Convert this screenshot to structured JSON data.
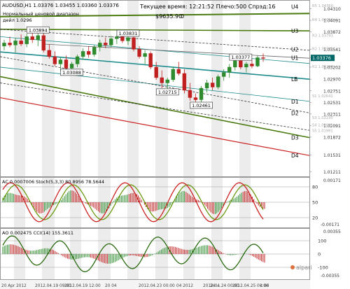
{
  "header": {
    "symbol_line": "AUDUSD,H1  1.03376 1.03455 1.03360 1.03376",
    "info_lines": [
      "Нормальный ценовой диапазон",
      "дейл 1.0296"
    ],
    "time_label": "Текущее время: 12:21:52 Плечо:500 Спрэд:16",
    "balance": "$9635.90",
    "zero": "0"
  },
  "colors": {
    "up_candle": "#2e8b2e",
    "down_candle": "#c02020",
    "u_lines": "#4a7a10",
    "l_lines": "#1e8c8c",
    "d4_line": "#cc2222",
    "stoch_main": "#cc2222",
    "stoch_signal": "#6a9a10",
    "cci_line": "#2a6a10",
    "stripe": "#ececec",
    "price_box": "#006666"
  },
  "channel_labels": [
    {
      "text": "U4",
      "price": 1.0435
    },
    {
      "text": "U3",
      "price": 1.0389
    },
    {
      "text": "U2",
      "price": 1.0354
    },
    {
      "text": "U1",
      "price": 1.03376
    },
    {
      "text": "LB",
      "price": 1.0297
    },
    {
      "text": "D1",
      "price": 1.0255
    },
    {
      "text": "D2",
      "price": 1.0233
    },
    {
      "text": "D3",
      "price": 1.0186
    },
    {
      "text": "D4",
      "price": 1.0152
    }
  ],
  "price_axis": {
    "ticks": [
      "1.04310",
      "1.04091",
      "1.03872",
      "1.03541",
      "1.03376",
      "1.03202",
      "1.02970",
      "1.02751",
      "1.02531",
      "1.02311",
      "1.02091",
      "1.01872",
      "1.01531",
      "1.01211"
    ],
    "current_price": "1.03376",
    "level_tags": [
      {
        "text": "R5 1.04360",
        "price": 1.0436
      },
      {
        "text": "R4 1.04091",
        "price": 1.0409
      },
      {
        "text": "R3 1.03791",
        "price": 1.0379
      },
      {
        "text": "R2 1.03541",
        "price": 1.0354
      },
      {
        "text": "R1 1.03202",
        "price": 1.032
      },
      {
        "text": "S1 1.02641",
        "price": 1.0264
      },
      {
        "text": "S3 1.02230",
        "price": 1.0223
      },
      {
        "text": "S4 1.02091",
        "price": 1.0209
      },
      {
        "text": "S5 1.01981",
        "price": 1.0198
      }
    ]
  },
  "price_annotations": [
    {
      "text": "1.03894",
      "price": 1.03894,
      "bar": 6
    },
    {
      "text": "1.03088",
      "price": 1.03088,
      "bar": 12
    },
    {
      "text": "1.03831",
      "price": 1.03831,
      "bar": 22
    },
    {
      "text": "1.02715",
      "price": 1.02715,
      "bar": 29
    },
    {
      "text": "1.03377",
      "price": 1.03377,
      "bar": 42
    },
    {
      "text": "1.02461",
      "price": 1.02461,
      "bar": 35
    }
  ],
  "indicator1": {
    "label": "AC 0.0007006  Stoch(5,3,3) 80.8956 78.5644",
    "levels": [
      "80",
      "50",
      "20"
    ],
    "ticks": [
      "0.00171",
      "-0.00171"
    ]
  },
  "indicator2": {
    "label": "AO 0.002475  CCI(14) 155.3611",
    "levels": [
      "100",
      "0",
      "-100"
    ],
    "ticks": [
      "0.00355",
      "-0.00355"
    ],
    "watermark": "alpari"
  },
  "time_axis": [
    "20 Apr 2012",
    "2012.04.19 09:00",
    "2012.04.19 12:00",
    "20 04",
    "2012.04.23 00:00",
    "04 2012",
    "2012.04.24 00:00",
    "24 ...",
    "2012.04.25 00:00",
    "c 04"
  ],
  "chart_data": {
    "type": "candlestick",
    "symbol": "AUDUSD",
    "timeframe": "H1",
    "ohlc": [
      [
        1.036,
        1.0372,
        1.0352,
        1.0366
      ],
      [
        1.0366,
        1.0378,
        1.0358,
        1.0362
      ],
      [
        1.0362,
        1.0375,
        1.0348,
        1.037
      ],
      [
        1.037,
        1.0382,
        1.036,
        1.0364
      ],
      [
        1.0364,
        1.0384,
        1.0358,
        1.0378
      ],
      [
        1.0378,
        1.0389,
        1.0366,
        1.0372
      ],
      [
        1.0372,
        1.0386,
        1.036,
        1.038
      ],
      [
        1.038,
        1.0385,
        1.0348,
        1.0352
      ],
      [
        1.0352,
        1.0364,
        1.0336,
        1.034
      ],
      [
        1.034,
        1.035,
        1.0322,
        1.0326
      ],
      [
        1.0326,
        1.0338,
        1.0312,
        1.0334
      ],
      [
        1.0334,
        1.0342,
        1.0316,
        1.0318
      ],
      [
        1.0318,
        1.033,
        1.0309,
        1.0326
      ],
      [
        1.0326,
        1.0344,
        1.032,
        1.034
      ],
      [
        1.034,
        1.0356,
        1.0334,
        1.035
      ],
      [
        1.035,
        1.036,
        1.0338,
        1.0344
      ],
      [
        1.0344,
        1.0362,
        1.034,
        1.0358
      ],
      [
        1.0358,
        1.0372,
        1.035,
        1.0366
      ],
      [
        1.0366,
        1.0376,
        1.0356,
        1.0362
      ],
      [
        1.0362,
        1.038,
        1.0358,
        1.0374
      ],
      [
        1.0374,
        1.0383,
        1.0364,
        1.0378
      ],
      [
        1.0378,
        1.0384,
        1.0366,
        1.037
      ],
      [
        1.037,
        1.0383,
        1.0362,
        1.0376
      ],
      [
        1.0376,
        1.038,
        1.035,
        1.0354
      ],
      [
        1.0354,
        1.036,
        1.0336,
        1.034
      ],
      [
        1.034,
        1.0352,
        1.0326,
        1.0346
      ],
      [
        1.0346,
        1.035,
        1.0316,
        1.032
      ],
      [
        1.032,
        1.033,
        1.0296,
        1.03
      ],
      [
        1.03,
        1.0314,
        1.028,
        1.029
      ],
      [
        1.029,
        1.03,
        1.0271,
        1.0296
      ],
      [
        1.0296,
        1.032,
        1.0292,
        1.0316
      ],
      [
        1.0316,
        1.033,
        1.0304,
        1.0308
      ],
      [
        1.0308,
        1.0316,
        1.027,
        1.0276
      ],
      [
        1.0276,
        1.029,
        1.0256,
        1.0262
      ],
      [
        1.0262,
        1.027,
        1.0246,
        1.0258
      ],
      [
        1.0258,
        1.0284,
        1.025,
        1.028
      ],
      [
        1.028,
        1.0296,
        1.0272,
        1.029
      ],
      [
        1.029,
        1.03,
        1.0276,
        1.0282
      ],
      [
        1.0282,
        1.0306,
        1.0278,
        1.0302
      ],
      [
        1.0302,
        1.0316,
        1.0294,
        1.031
      ],
      [
        1.031,
        1.0326,
        1.03,
        1.032
      ],
      [
        1.032,
        1.0338,
        1.0314,
        1.0332
      ],
      [
        1.0332,
        1.0338,
        1.0316,
        1.032
      ],
      [
        1.032,
        1.033,
        1.031,
        1.0326
      ],
      [
        1.0326,
        1.0336,
        1.0318,
        1.0322
      ],
      [
        1.0322,
        1.0342,
        1.032,
        1.0338
      ],
      [
        1.0338,
        1.0346,
        1.033,
        1.0337
      ]
    ]
  }
}
